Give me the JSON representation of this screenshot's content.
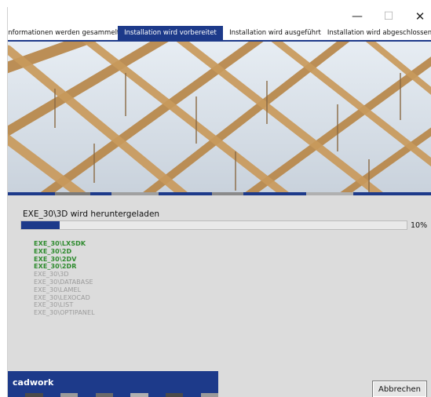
{
  "window": {
    "controls": {
      "minimize": "—",
      "maximize": "☐",
      "close": "✕"
    },
    "icons": {
      "minimize": "minimize-icon",
      "maximize": "maximize-icon",
      "close": "close-icon"
    }
  },
  "tabs": [
    {
      "label": "Informationen werden gesammelt",
      "active": false
    },
    {
      "label": "Installation wird vorbereitet",
      "active": true
    },
    {
      "label": "Installation wird ausgeführt",
      "active": false
    },
    {
      "label": "Installation wird abgeschlossen",
      "active": false
    }
  ],
  "status": {
    "text": "EXE_30\\3D wird heruntergeladen",
    "progress": 10,
    "progress_label": "10%"
  },
  "components": [
    {
      "name": "EXE_30\\LXSDK",
      "state": "done"
    },
    {
      "name": "EXE_30\\2D",
      "state": "done"
    },
    {
      "name": "EXE_30\\2DV",
      "state": "done"
    },
    {
      "name": "EXE_30\\2DR",
      "state": "done"
    },
    {
      "name": "EXE_30\\3D",
      "state": "pending"
    },
    {
      "name": "EXE_30\\DATABASE",
      "state": "pending"
    },
    {
      "name": "EXE_30\\LAMEL",
      "state": "pending"
    },
    {
      "name": "EXE_30\\LEXOCAD",
      "state": "pending"
    },
    {
      "name": "EXE_30\\LIST",
      "state": "pending"
    },
    {
      "name": "EXE_30\\OPTIPANEL",
      "state": "pending"
    }
  ],
  "footer": {
    "brand": "cadwork",
    "abort_label": "Abbrechen"
  },
  "colors": {
    "accent": "#1d3a8a",
    "done": "#2e8b2e",
    "pending": "#9a9a9a",
    "background": "#dcdcdc"
  }
}
